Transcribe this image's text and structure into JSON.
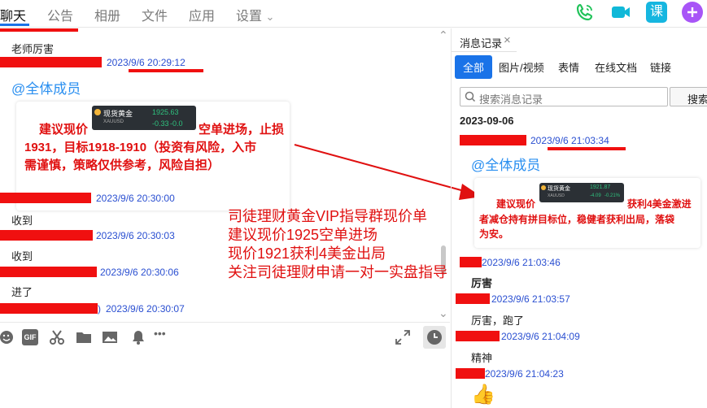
{
  "nav": {
    "tabs": [
      "聊天",
      "公告",
      "相册",
      "文件",
      "应用",
      "设置"
    ],
    "settings_arrow": "⌄",
    "icons": [
      "phone-icon",
      "video-call-icon",
      "course-icon",
      "add-icon"
    ],
    "course_label": "课"
  },
  "chat": {
    "collapse_arrow": "⌃",
    "expand_arrow": "⌄",
    "messages": [
      {
        "text": "老师厉害"
      },
      {
        "time": "2023/9/6 20:29:12"
      },
      {
        "mention": "@全体成员"
      },
      {
        "card_text": "建议现价1925空单进场，止损1931，目标1918-1910（投资有风险，入市需谨慎，策略仅供参考，风险自担）",
        "line1_left": "建议现价",
        "line1_right": "空单进场，止损",
        "line2": "1931，目标1918-1910（投资有风险，入市",
        "line3": "需谨慎，策略仅供参考，风险自担）",
        "mini_title": "现货黄金",
        "mini_value": "1925.63",
        "mini_code": "XAUUSD",
        "mini_change": "-0.33",
        "mini_pct": "-0.0"
      },
      {
        "time": "2023/9/6 20:30:00",
        "text": "收到"
      },
      {
        "time": "2023/9/6 20:30:03",
        "text": "收到"
      },
      {
        "time": "2023/9/6 20:30:06",
        "text": "进了"
      },
      {
        "time": "2023/9/6 20:30:07"
      }
    ],
    "time_prefix_paren": ")"
  },
  "overlay": {
    "lines": [
      "司徒理财黄金VIP指导群现价单",
      "建议现价1925空单进场",
      "现价1921获利4美金出局",
      "关注司徒理财申请一对一实盘指导"
    ]
  },
  "toolbar": {
    "tools": [
      "emoji-icon",
      "gif-icon",
      "scissors-icon",
      "folder-icon",
      "image-icon",
      "bell-icon",
      "more-icon"
    ],
    "gif_label": "GIF",
    "more_label": "•••"
  },
  "history": {
    "title": "消息记录",
    "close": "×",
    "tabs": [
      "全部",
      "图片/视频",
      "表情",
      "在线文档",
      "链接"
    ],
    "search_placeholder": "搜索消息记录",
    "search_button": "搜索",
    "date": "2023-09-06",
    "items": [
      {
        "time": "2023/9/6 21:03:34"
      },
      {
        "mention": "@全体成员"
      },
      {
        "card_left": "建议现价",
        "card_right": "获利4美金激进",
        "card_line2": "者减仓持有拼目标位，稳健者获利出局，落袋",
        "card_line3": "为安。",
        "mini_title": "现货黄金",
        "mini_value": "1921.87",
        "mini_code": "XAUUSD",
        "mini_change": "-4.09",
        "mini_pct": "-0.21%"
      },
      {
        "time": "2023/9/6 21:03:46",
        "text": "厉害"
      },
      {
        "time": "2023/9/6 21:03:57",
        "text": "厉害，跑了"
      },
      {
        "time": "2023/9/6 21:04:09",
        "text": "精神"
      },
      {
        "time": "2023/9/6 21:04:23",
        "emoji": "👍"
      }
    ]
  },
  "colors": {
    "accent": "#1a73e8",
    "redact": "#f01010",
    "timestamp": "#2a4fd1",
    "warning_text": "#e01010",
    "phone": "#21c35a",
    "video": "#10b8d8",
    "course": "#16b6e0",
    "add": "#a855f7"
  }
}
